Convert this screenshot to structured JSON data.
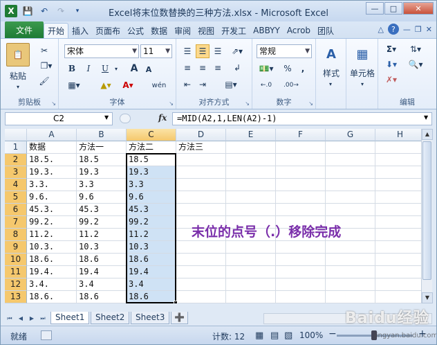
{
  "title": "Excel将末位数替换的三种方法.xlsx - Microsoft Excel",
  "tabs": {
    "file": "文件",
    "items": [
      "开始",
      "插入",
      "页面布",
      "公式",
      "数据",
      "审阅",
      "视图",
      "开发工",
      "ABBYY",
      "Acrob",
      "团队"
    ]
  },
  "ribbon": {
    "clipboard": {
      "paste": "粘贴",
      "label": "剪贴板"
    },
    "font": {
      "name": "宋体",
      "size": "11",
      "bold": "B",
      "italic": "I",
      "underline": "U",
      "grow": "A",
      "shrink": "A",
      "wen": "wén",
      "label": "字体"
    },
    "alignment": {
      "label": "对齐方式"
    },
    "number": {
      "format": "常规",
      "label": "数字",
      "percent": "%",
      "comma": ","
    },
    "styles": {
      "label": "样式"
    },
    "cells": {
      "label": "单元格"
    },
    "editing": {
      "label": "编辑"
    }
  },
  "formula_bar": {
    "name_box": "C2",
    "fx": "fx",
    "formula": "=MID(A2,1,LEN(A2)-1)"
  },
  "columns": [
    "A",
    "B",
    "C",
    "D",
    "E",
    "F",
    "G",
    "H"
  ],
  "rows": [
    "1",
    "2",
    "3",
    "4",
    "5",
    "6",
    "7",
    "8",
    "9",
    "10",
    "11",
    "12",
    "13",
    "14"
  ],
  "cells": {
    "headers": [
      "数据",
      "方法一",
      "方法二",
      "方法三"
    ],
    "A": [
      "18.5.",
      "19.3.",
      "3.3.",
      "9.6.",
      "45.3.",
      "99.2.",
      "11.2.",
      "10.3.",
      "18.6.",
      "19.4.",
      "3.4.",
      "18.6."
    ],
    "B": [
      "18.5",
      "19.3",
      "3.3",
      "9.6",
      "45.3",
      "99.2",
      "11.2",
      "10.3",
      "18.6",
      "19.4",
      "3.4",
      "18.6"
    ],
    "C": [
      "18.5",
      "19.3",
      "3.3",
      "9.6",
      "45.3",
      "99.2",
      "11.2",
      "10.3",
      "18.6",
      "19.4",
      "3.4",
      "18.6"
    ]
  },
  "annotation": "末位的点号（.）移除完成",
  "sheets": [
    "Sheet1",
    "Sheet2",
    "Sheet3"
  ],
  "status": {
    "ready": "就绪",
    "count": "计数: 12",
    "zoom": "100%"
  },
  "watermark": {
    "main": "Baidu经验",
    "sub": "jingyan.baidu.com"
  },
  "colors": {
    "file_tab": "#1e7b34",
    "selection": "#cfe2f5",
    "annotation": "#7a2eaa"
  }
}
